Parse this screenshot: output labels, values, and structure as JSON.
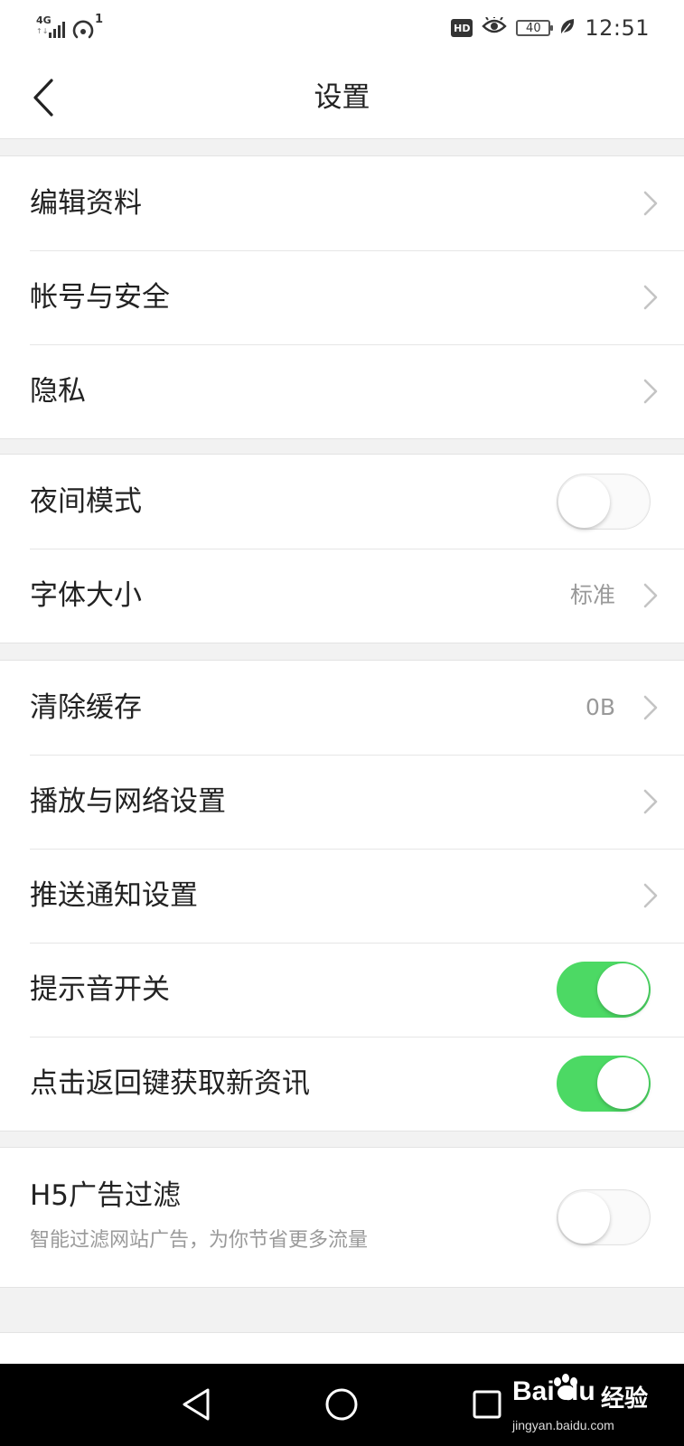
{
  "status_bar": {
    "network_type": "4G",
    "data_indicator": "↑↓",
    "hotspot_count": "1",
    "hd_badge": "HD",
    "battery_level": "40",
    "time": "12:51",
    "icons": [
      "signal-icon",
      "hotspot-icon",
      "eye-icon",
      "battery-icon",
      "leaf-icon"
    ]
  },
  "header": {
    "title": "设置"
  },
  "groups": [
    {
      "items": [
        {
          "label": "编辑资料",
          "control": "chevron"
        },
        {
          "label": "帐号与安全",
          "control": "chevron"
        },
        {
          "label": "隐私",
          "control": "chevron"
        }
      ]
    },
    {
      "items": [
        {
          "label": "夜间模式",
          "control": "toggle",
          "on": false
        },
        {
          "label": "字体大小",
          "control": "chevron",
          "value": "标准"
        }
      ]
    },
    {
      "items": [
        {
          "label": "清除缓存",
          "control": "chevron",
          "value": "0B"
        },
        {
          "label": "播放与网络设置",
          "control": "chevron"
        },
        {
          "label": "推送通知设置",
          "control": "chevron"
        },
        {
          "label": "提示音开关",
          "control": "toggle",
          "on": true
        },
        {
          "label": "点击返回键获取新资讯",
          "control": "toggle",
          "on": true
        }
      ]
    },
    {
      "items": [
        {
          "label": "H5广告过滤",
          "subtitle": "智能过滤网站广告，为你节省更多流量",
          "control": "toggle",
          "on": false
        }
      ]
    }
  ],
  "watermark": {
    "logo": "Bai du",
    "name": "经验",
    "url": "jingyan.baidu.com"
  },
  "colors": {
    "toggle_on": "#4cd964",
    "background": "#f2f2f2",
    "text": "#222222",
    "secondary_text": "#999999"
  }
}
